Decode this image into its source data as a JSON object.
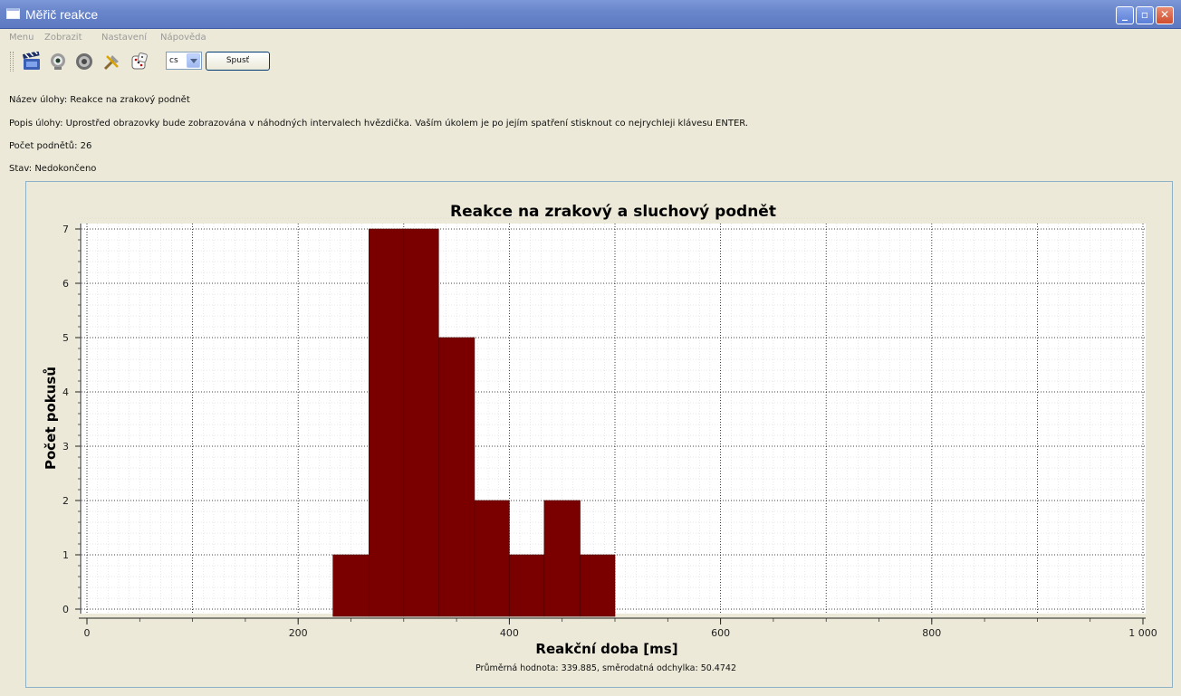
{
  "window": {
    "title": "Měřič reakce",
    "controls": {
      "minimize": "_",
      "maximize": "▫",
      "close": "✕"
    }
  },
  "menubar": {
    "items": [
      "Menu",
      "Zobrazit",
      "Nastavení",
      "Nápověda"
    ]
  },
  "toolbar": {
    "icons": [
      "clapperboard-icon",
      "webcam-icon",
      "speaker-icon",
      "tools-icon",
      "dice-icon"
    ],
    "language_value": "cs",
    "start_label": "Spusť"
  },
  "task": {
    "name": "Název úlohy: Reakce na zrakový podnět",
    "description": "Popis úlohy: Uprostřed obrazovky bude zobrazována v náhodných intervalech hvězdička. Vaším úkolem je po jejím spatření stisknout co nejrychleji klávesu ENTER.",
    "stimuli_count": "Počet podnětů: 26",
    "status": "Stav: Nedokončeno"
  },
  "chart_data": {
    "type": "bar",
    "title": "Reakce na zrakový a sluchový podnět",
    "xlabel": "Reakční doba [ms]",
    "ylabel": "Počet pokusů",
    "footer": "Průměrná hodnota: 339.885, směrodatná odchylka: 50.4742",
    "xlim": [
      0,
      1000
    ],
    "ylim": [
      0,
      7
    ],
    "xticks": [
      0,
      200,
      400,
      600,
      800,
      1000
    ],
    "xtick_labels": [
      "0",
      "200",
      "400",
      "600",
      "800",
      "1 000"
    ],
    "yticks": [
      0,
      1,
      2,
      3,
      4,
      5,
      6,
      7
    ],
    "grid": true,
    "bar_color": "#7a0000",
    "bins": [
      {
        "start": 233,
        "end": 267,
        "value": 1
      },
      {
        "start": 267,
        "end": 300,
        "value": 7
      },
      {
        "start": 300,
        "end": 333,
        "value": 7
      },
      {
        "start": 333,
        "end": 367,
        "value": 5
      },
      {
        "start": 367,
        "end": 400,
        "value": 2
      },
      {
        "start": 400,
        "end": 433,
        "value": 1
      },
      {
        "start": 433,
        "end": 467,
        "value": 2
      },
      {
        "start": 467,
        "end": 500,
        "value": 1
      }
    ]
  }
}
